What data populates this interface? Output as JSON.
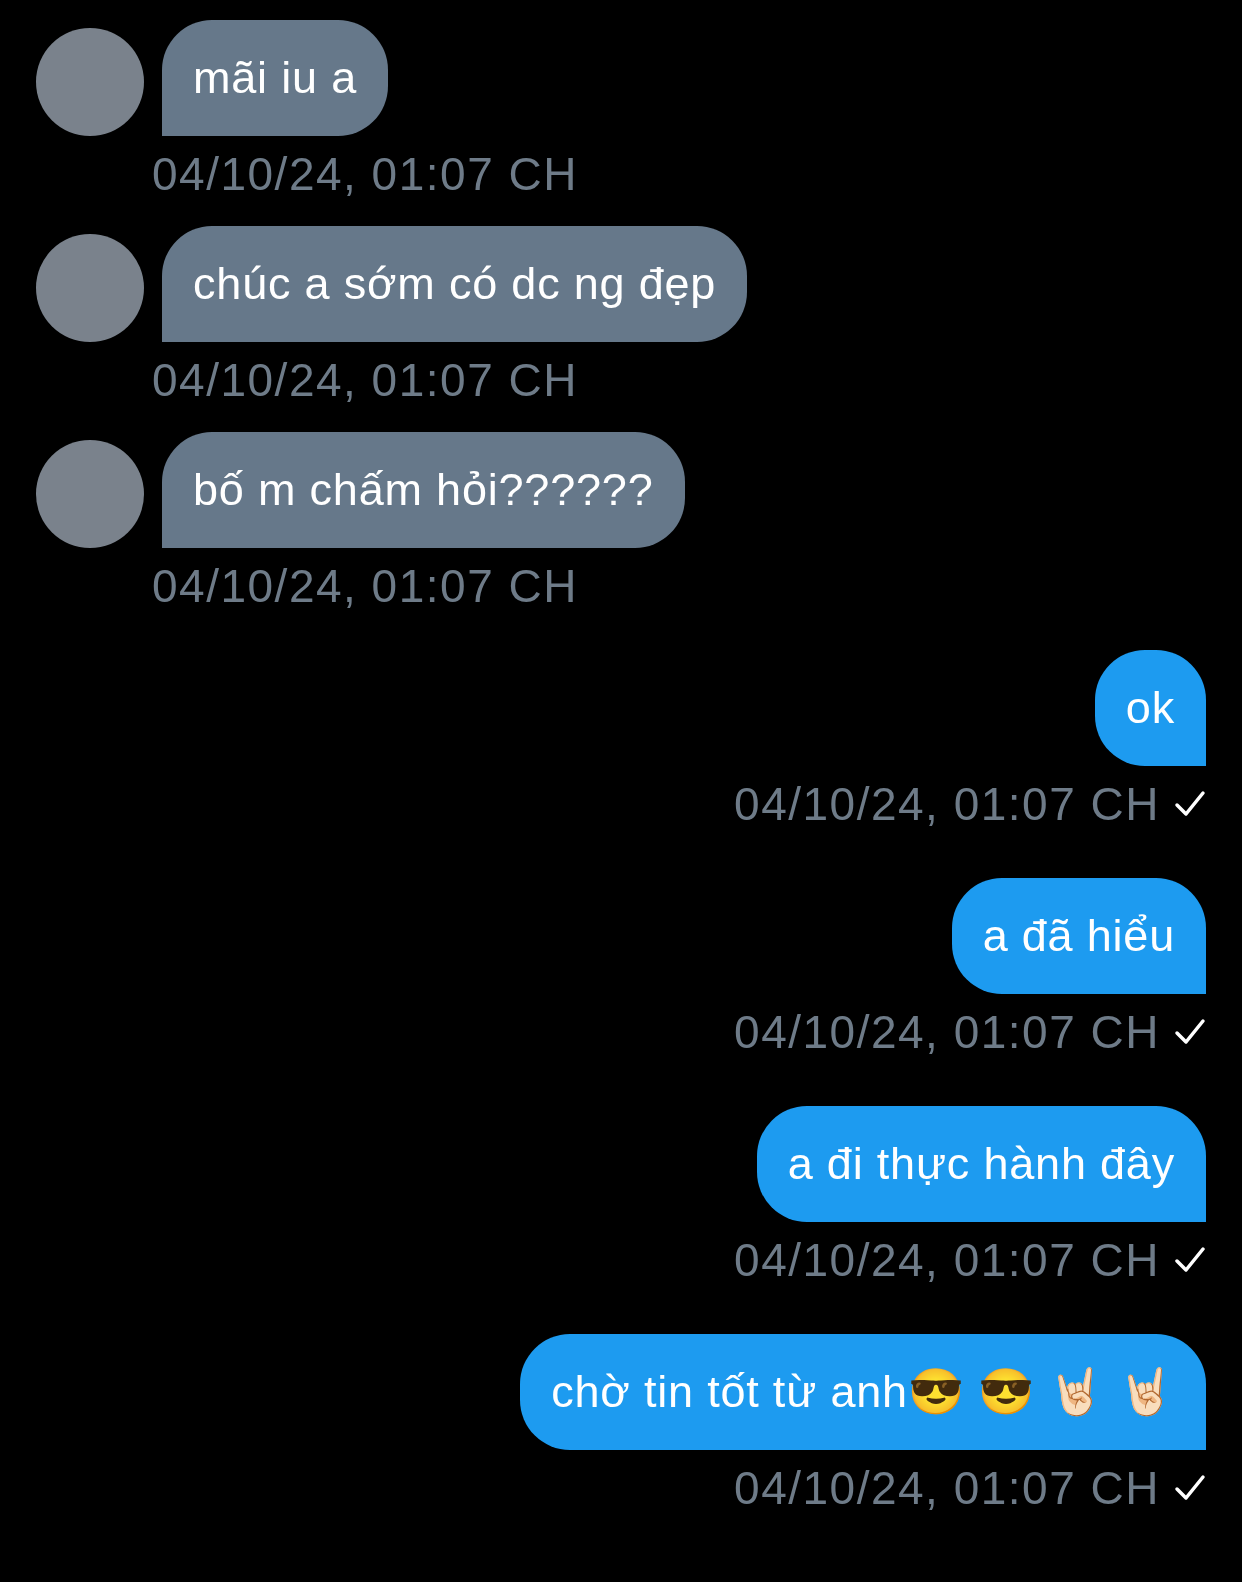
{
  "messages": [
    {
      "kind": "incoming",
      "text": "mãi iu a",
      "time": "04/10/24, 01:07 CH"
    },
    {
      "kind": "incoming",
      "text": "chúc a sớm có dc ng đẹp",
      "time": "04/10/24, 01:07 CH"
    },
    {
      "kind": "incoming",
      "text": "bố m chấm hỏi??????",
      "time": "04/10/24, 01:07 CH"
    },
    {
      "kind": "outgoing",
      "text": "ok",
      "time": "04/10/24, 01:07 CH",
      "sent": true
    },
    {
      "kind": "outgoing",
      "text": "a đã hiểu",
      "time": "04/10/24, 01:07 CH",
      "sent": true
    },
    {
      "kind": "outgoing",
      "text": "a đi thực hành đây",
      "time": "04/10/24, 01:07 CH",
      "sent": true
    },
    {
      "kind": "outgoing",
      "text": "chờ tin tốt từ anh😎 😎 🤘🏻 🤘🏻",
      "time": "04/10/24, 01:07 CH",
      "sent": true
    }
  ]
}
